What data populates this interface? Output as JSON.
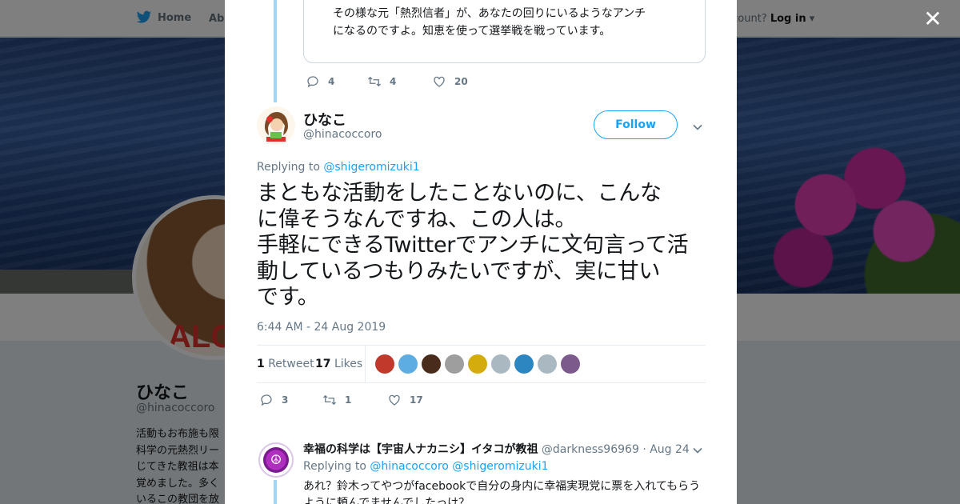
{
  "nav": {
    "home_label": "Home",
    "about_label": "Abo",
    "login_prompt": "account? ",
    "login_label": "Log in"
  },
  "profile": {
    "name": "ひなこ",
    "handle": "@hinacoccoro",
    "bio_lines": [
      "活動もお布施も限",
      "科学の元熱烈リー",
      "じてきた教祖は本",
      "覚めました。多く",
      "いるこの教団を放"
    ],
    "avatar_text": "ALO"
  },
  "modal": {
    "close_label": "✕",
    "quoted_text": "その様な元「熱烈信者」が、あなたの回りにいるようなアンチになるのですよ。知恵を使って選挙戦を戦っています。",
    "prev_actions": {
      "reply": "4",
      "retweet": "4",
      "like": "20"
    },
    "tweet": {
      "name": "ひなこ",
      "handle": "@hinacoccoro",
      "follow_label": "Follow",
      "replying_prefix": "Replying to",
      "replying_to": "@shigeromizuki1",
      "text_lines": [
        "まともな活動をしたことないのに、こんな",
        "に偉そうなんですね、この人は。",
        "手軽にできるTwitterでアンチに文句言って活",
        "動しているつもりみたいですが、実に甘い",
        "です。"
      ],
      "timestamp": "6:44 AM - 24 Aug 2019",
      "retweets_count": "1",
      "retweets_label": "Retweet",
      "likes_count": "17",
      "likes_label": "Likes",
      "liker_colors": [
        "#c0392b",
        "#5dade2",
        "#4a2c1d",
        "#9e9e9e",
        "#d4ac0d",
        "#aab8c2",
        "#2e86c1",
        "#aab8c2",
        "#7d5a8c"
      ],
      "actions": {
        "reply": "3",
        "retweet": "1",
        "like": "17"
      }
    },
    "reply": {
      "name": "幸福の科学は【宇宙人ナカニシ】イタコが教祖",
      "handle": "@darkness96969",
      "date": "· Aug 24",
      "replying_prefix": "Replying to",
      "replying_to_1": "@hinacoccoro",
      "replying_to_2": "@shigeromizuki1",
      "text": "あれ？鈴木ってやつがfacebookで自分の身内に幸福実現党に票を入れてもらうように頼んでませんでしたっけ？"
    }
  }
}
